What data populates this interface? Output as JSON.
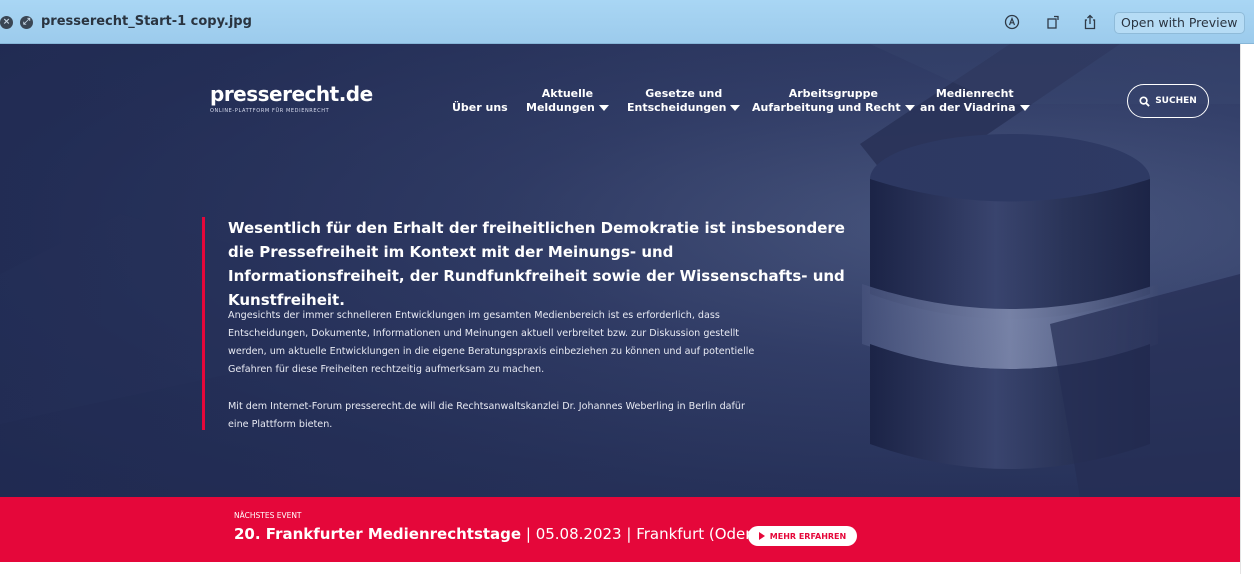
{
  "window": {
    "filename": "presserecht_Start-1 copy.jpg",
    "open_with_label": "Open with Preview",
    "icons": [
      "close-icon",
      "zoom-icon",
      "markup-icon",
      "rotate-icon",
      "share-icon"
    ]
  },
  "site": {
    "logo": "presserecht.de",
    "tagline": "ONLINE-PLATTFORM FÜR MEDIENRECHT",
    "nav": [
      {
        "line1": "",
        "line2": "Über uns",
        "dropdown": false
      },
      {
        "line1": "Aktuelle",
        "line2": "Meldungen",
        "dropdown": true
      },
      {
        "line1": "Gesetze und",
        "line2": "Entscheidungen",
        "dropdown": true
      },
      {
        "line1": "Arbeitsgruppe",
        "line2": "Aufarbeitung und Recht",
        "dropdown": true
      },
      {
        "line1": "Medienrecht",
        "line2": "an der Viadrina",
        "dropdown": true
      }
    ],
    "search_label": "SUCHEN",
    "headline": "Wesentlich für den Erhalt der freiheitlichen Demokratie ist insbesondere die Pressefreiheit im Kontext mit der Meinungs- und Informationsfreiheit, der Rundfunkfreiheit sowie der Wissenschafts- und Kunstfreiheit.",
    "paragraph1": "Angesichts der immer schnelleren Entwicklungen im gesamten Medienbereich ist es erforderlich, dass Entscheidungen, Dokumente, Informationen und Meinungen aktuell verbreitet bzw. zur Diskussion gestellt werden, um aktuelle Entwicklungen in die eigene Beratungspraxis einbeziehen zu können und auf potentielle Gefahren für diese Freiheiten rechtzeitig aufmerksam zu machen.",
    "paragraph2": "Mit dem Internet-Forum presserecht.de will die Rechtsanwaltskanzlei Dr. Johannes Weberling in Berlin dafür eine Plattform bieten.",
    "event": {
      "kicker": "NÄCHSTES EVENT",
      "title": "20. Frankfurter Medienrechtstage",
      "sep1": " | ",
      "date": "05.08.2023",
      "sep2": " | ",
      "place": "Frankfurt (Oder)",
      "button": "MEHR ERFAHREN"
    }
  },
  "colors": {
    "accent": "#e5073a",
    "hero_dark": "#27325a",
    "titlebar": "#a9d6f4"
  }
}
